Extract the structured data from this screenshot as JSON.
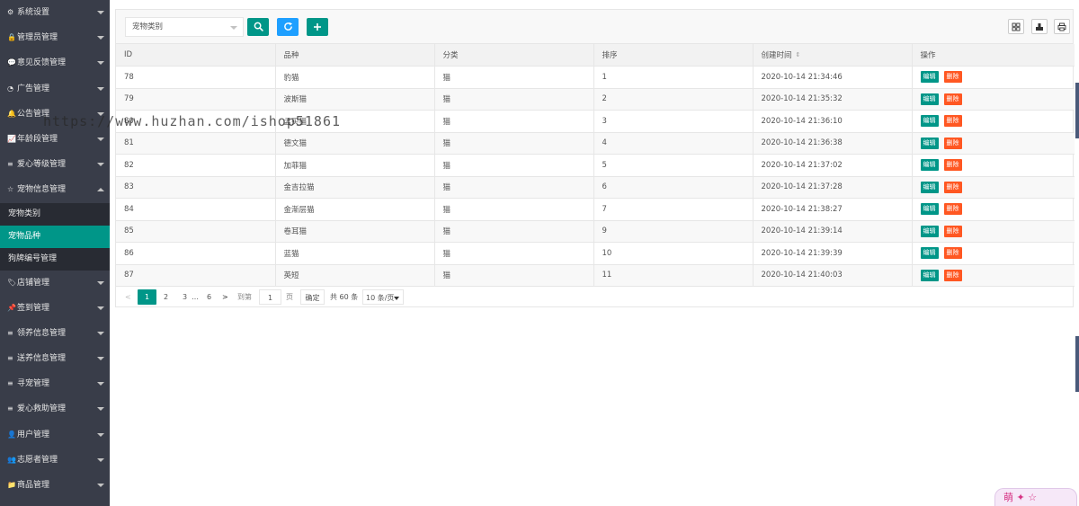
{
  "sidebar": {
    "items": [
      {
        "icon": "gear-icon",
        "glyph": "⚙",
        "label": "系统设置",
        "expanded": false
      },
      {
        "icon": "lock-icon",
        "glyph": "🔒",
        "label": "管理员管理",
        "expanded": false
      },
      {
        "icon": "chat-icon",
        "glyph": "💬",
        "label": "意见反馈管理",
        "expanded": false
      },
      {
        "icon": "compass-icon",
        "glyph": "◔",
        "label": "广告管理",
        "expanded": false
      },
      {
        "icon": "bell-icon",
        "glyph": "🔔",
        "label": "公告管理",
        "expanded": false
      },
      {
        "icon": "chart-icon",
        "glyph": "📈",
        "label": "年龄段管理",
        "expanded": false
      },
      {
        "icon": "list-icon",
        "glyph": "≡",
        "label": "爱心等级管理",
        "expanded": false
      },
      {
        "icon": "star-icon",
        "glyph": "☆",
        "label": "宠物信息管理",
        "expanded": true
      },
      {
        "icon": "tag-icon",
        "glyph": "🏷",
        "label": "店铺管理",
        "expanded": false
      },
      {
        "icon": "pin-icon",
        "glyph": "📌",
        "label": "签到管理",
        "expanded": false
      },
      {
        "icon": "list-icon",
        "glyph": "≡",
        "label": "领养信息管理",
        "expanded": false
      },
      {
        "icon": "list-icon",
        "glyph": "≡",
        "label": "送养信息管理",
        "expanded": false
      },
      {
        "icon": "list-icon",
        "glyph": "≡",
        "label": "寻宠管理",
        "expanded": false
      },
      {
        "icon": "list-icon",
        "glyph": "≡",
        "label": "爱心救助管理",
        "expanded": false
      },
      {
        "icon": "user-icon",
        "glyph": "👤",
        "label": "用户管理",
        "expanded": false
      },
      {
        "icon": "users-icon",
        "glyph": "👥",
        "label": "志愿者管理",
        "expanded": false
      },
      {
        "icon": "folder-icon",
        "glyph": "📁",
        "label": "商品管理",
        "expanded": false
      }
    ],
    "children": [
      {
        "label": "宠物类别",
        "active": false
      },
      {
        "label": "宠物品种",
        "active": true
      },
      {
        "label": "狗牌编号管理",
        "active": false
      }
    ]
  },
  "toolbar": {
    "category_placeholder": "宠物类别",
    "search_icon": "search-icon",
    "refresh_icon": "refresh-icon",
    "add_icon": "plus-icon"
  },
  "table": {
    "columns": [
      "ID",
      "品种",
      "分类",
      "排序",
      "创建时间",
      "操作"
    ],
    "sortable_column": "创建时间",
    "edit_label": "编辑",
    "delete_label": "删除",
    "rows": [
      {
        "id": "78",
        "breed": "豹猫",
        "category": "猫",
        "sort": "1",
        "created": "2020-10-14 21:34:46"
      },
      {
        "id": "79",
        "breed": "波斯猫",
        "category": "猫",
        "sort": "2",
        "created": "2020-10-14 21:35:32"
      },
      {
        "id": "80",
        "breed": "孟买猫",
        "category": "猫",
        "sort": "3",
        "created": "2020-10-14 21:36:10"
      },
      {
        "id": "81",
        "breed": "德文猫",
        "category": "猫",
        "sort": "4",
        "created": "2020-10-14 21:36:38"
      },
      {
        "id": "82",
        "breed": "加菲猫",
        "category": "猫",
        "sort": "5",
        "created": "2020-10-14 21:37:02"
      },
      {
        "id": "83",
        "breed": "金吉拉猫",
        "category": "猫",
        "sort": "6",
        "created": "2020-10-14 21:37:28"
      },
      {
        "id": "84",
        "breed": "金渐层猫",
        "category": "猫",
        "sort": "7",
        "created": "2020-10-14 21:38:27"
      },
      {
        "id": "85",
        "breed": "卷耳猫",
        "category": "猫",
        "sort": "9",
        "created": "2020-10-14 21:39:14"
      },
      {
        "id": "86",
        "breed": "蓝猫",
        "category": "猫",
        "sort": "10",
        "created": "2020-10-14 21:39:39"
      },
      {
        "id": "87",
        "breed": "英短",
        "category": "猫",
        "sort": "11",
        "created": "2020-10-14 21:40:03"
      }
    ]
  },
  "pager": {
    "current": "1",
    "pages": [
      "2",
      "3"
    ],
    "ellipsis": "…",
    "last": "6",
    "goto_label": "到第",
    "goto_value": "1",
    "page_unit": "页",
    "confirm_label": "确定",
    "total_label": "共 60 条",
    "page_size": "10 条/页"
  },
  "watermark": "https://www.huzhan.com/ishop51861",
  "corner_text": "萌"
}
